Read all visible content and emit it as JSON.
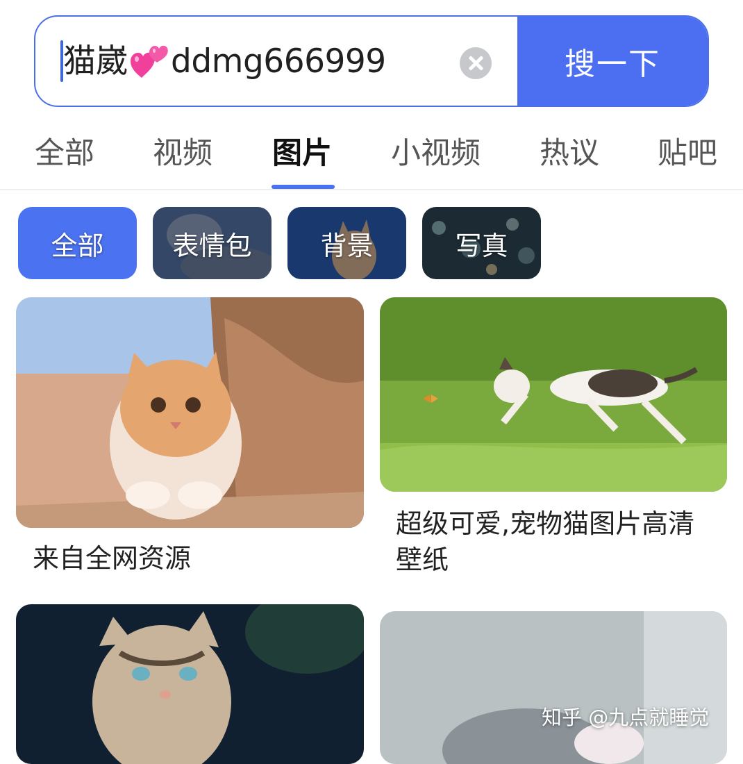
{
  "search": {
    "query_prefix": "猫崴",
    "query_emoji": "heart-emoji",
    "query_suffix": "ddmg666999",
    "button_label": "搜一下"
  },
  "tabs": [
    {
      "label": "全部",
      "active": false
    },
    {
      "label": "视频",
      "active": false
    },
    {
      "label": "图片",
      "active": true
    },
    {
      "label": "小视频",
      "active": false
    },
    {
      "label": "热议",
      "active": false
    },
    {
      "label": "贴吧",
      "active": false
    }
  ],
  "filters": [
    {
      "label": "全部",
      "selected": true
    },
    {
      "label": "表情包",
      "selected": false
    },
    {
      "label": "背景",
      "selected": false
    },
    {
      "label": "写真",
      "selected": false
    }
  ],
  "results": [
    {
      "caption": "来自全网资源",
      "image": "orange-white kitten looking up over a rock ledge"
    },
    {
      "caption": "超级可爱,宠物猫图片高清壁纸",
      "image": "calico kitten leaping over grass toward a butterfly"
    },
    {
      "caption": "",
      "image": "tabby kitten with paws raised, dark background"
    },
    {
      "caption": "",
      "image": "grey kitten against light grey background"
    }
  ],
  "watermark": "知乎 @九点就睡觉",
  "colors": {
    "accent": "#4b6ff0",
    "tab_indicator": "#4a72f0",
    "search_border": "#4a6fe8"
  }
}
